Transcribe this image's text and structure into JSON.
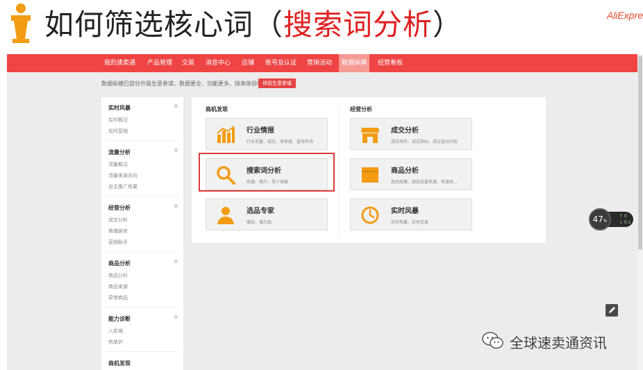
{
  "slide": {
    "title_main": "如何筛选核心词（",
    "title_highlight": "搜索词分析",
    "title_end": "）",
    "brand": "AliExpre"
  },
  "nav": {
    "items": [
      "我的速卖通",
      "产品管理",
      "交易",
      "消息中心",
      "店铺",
      "账号及认证",
      "营销活动",
      "数据纵横",
      "经营看板"
    ],
    "active": "数据纵横"
  },
  "notice": {
    "text": "数据纵横已部分升级生意参谋，数据更全、功能更多、快来体验吧！",
    "button": "体验生意参谋"
  },
  "sidebar": {
    "groups": [
      {
        "title": "实时风暴",
        "items": [
          "实时概况",
          "实时营销"
        ]
      },
      {
        "title": "流量分析",
        "items": [
          "流量概况",
          "流量来源去向",
          "自主推广效果"
        ]
      },
      {
        "title": "经营分析",
        "items": [
          "成交分析",
          "商铺装修",
          "营销助手"
        ]
      },
      {
        "title": "商品分析",
        "items": [
          "商品分析",
          "商品来源",
          "异常商品"
        ]
      },
      {
        "title": "能力诊断",
        "items": [
          "八卦镜",
          "热单护"
        ]
      },
      {
        "title": "商机发现",
        "items": []
      }
    ],
    "toggle": "⊖"
  },
  "panel": {
    "left_title": "商机发现",
    "right_title": "经营分析",
    "cards": [
      {
        "title": "行业情报",
        "desc": "行业流量、成交、竞争度、蓝海市场",
        "icon": "chart-icon"
      },
      {
        "title": "搜索词分析",
        "desc": "热搜、飙升、零少结果",
        "icon": "magnifier-icon"
      },
      {
        "title": "选品专家",
        "desc": "爆品、潜力品",
        "icon": "person-icon"
      },
      {
        "title": "成交分析",
        "desc": "成交排名、成交指标、成交波动分析",
        "icon": "shop-icon"
      },
      {
        "title": "商品分析",
        "desc": "商品效果、商品流量来源、来源关...",
        "icon": "box-icon"
      },
      {
        "title": "实时风暴",
        "desc": "实时风暴、实时交易",
        "icon": "clock-icon"
      }
    ]
  },
  "speed": {
    "value": "47",
    "unit": "%",
    "up": "↑ 0",
    "down": "↓ 0.1"
  },
  "watermark": {
    "text": "全球速卖通资讯"
  },
  "colors": {
    "nav": "#ef4444",
    "accent_orange": "#f29b13",
    "highlight": "#d93a3a"
  }
}
